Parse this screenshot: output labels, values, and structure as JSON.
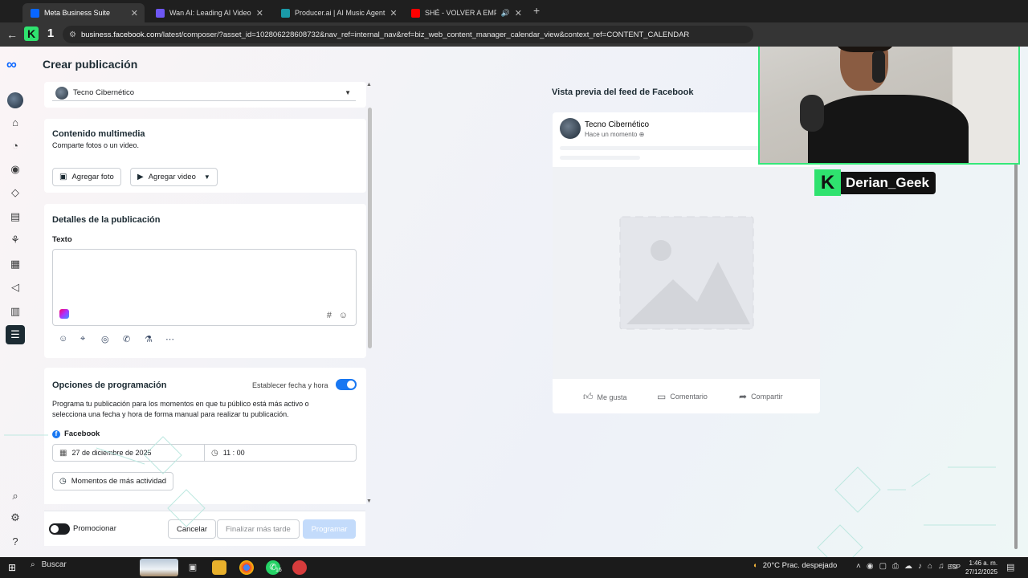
{
  "browser": {
    "tabs": [
      {
        "title": "Meta Business Suite",
        "favicon_color": "#0866ff",
        "active": true
      },
      {
        "title": "Wan AI: Leading AI Video Gene",
        "favicon_color": "#6e57f5",
        "active": false
      },
      {
        "title": "Producer.ai | AI Music Agent",
        "favicon_color": "#1a9aa8",
        "active": false
      },
      {
        "title": "SHÉ - VOLVER A EMPEZAR |",
        "favicon_color": "#ff0000",
        "active": false
      }
    ],
    "url_host": "business.facebook.com",
    "url_path": "/latest/composer/?asset_id=102806228608732&nav_ref=internal_nav&ref=biz_web_content_manager_calendar_view&context_ref=CONTENT_CALENDAR"
  },
  "page": {
    "title": "Crear publicación",
    "selected_page": "Tecno Cibernético",
    "media": {
      "heading": "Contenido multimedia",
      "subtitle": "Comparte fotos o un video.",
      "add_photo": "Agregar foto",
      "add_video": "Agregar video"
    },
    "details": {
      "heading": "Detalles de la publicación",
      "text_label": "Texto",
      "text_value": ""
    },
    "scheduling": {
      "heading": "Opciones de programación",
      "toggle_label": "Establecer fecha y hora",
      "toggle_on": true,
      "description": "Programa tu publicación para los momentos en que tu público está más activo o selecciona una fecha y hora de forma manual para realizar tu publicación.",
      "platform": "Facebook",
      "date": "27 de diciembre de 2025",
      "time": "11 : 00",
      "active_times_button": "Momentos de más actividad"
    },
    "footer": {
      "promote_label": "Promocionar",
      "promote_on": false,
      "cancel": "Cancelar",
      "finish_later": "Finalizar más tarde",
      "schedule": "Programar"
    },
    "preview": {
      "heading": "Vista previa del feed de Facebook",
      "page_name": "Tecno Cibernético",
      "time": "Hace un momento",
      "like": "Me gusta",
      "comment": "Comentario",
      "share": "Compartir"
    }
  },
  "overlay": {
    "streamer_name": "Derian_Geek"
  },
  "taskbar": {
    "search_placeholder": "Buscar",
    "weather": "20°C  Prac. despejado",
    "language": "ESP",
    "time": "1:46 a. m.",
    "date": "27/12/2025",
    "badge_count": "16"
  },
  "colors": {
    "accent": "#0a66ff",
    "toggle_on": "#1877f2",
    "streamer_green": "#2fe26f"
  }
}
